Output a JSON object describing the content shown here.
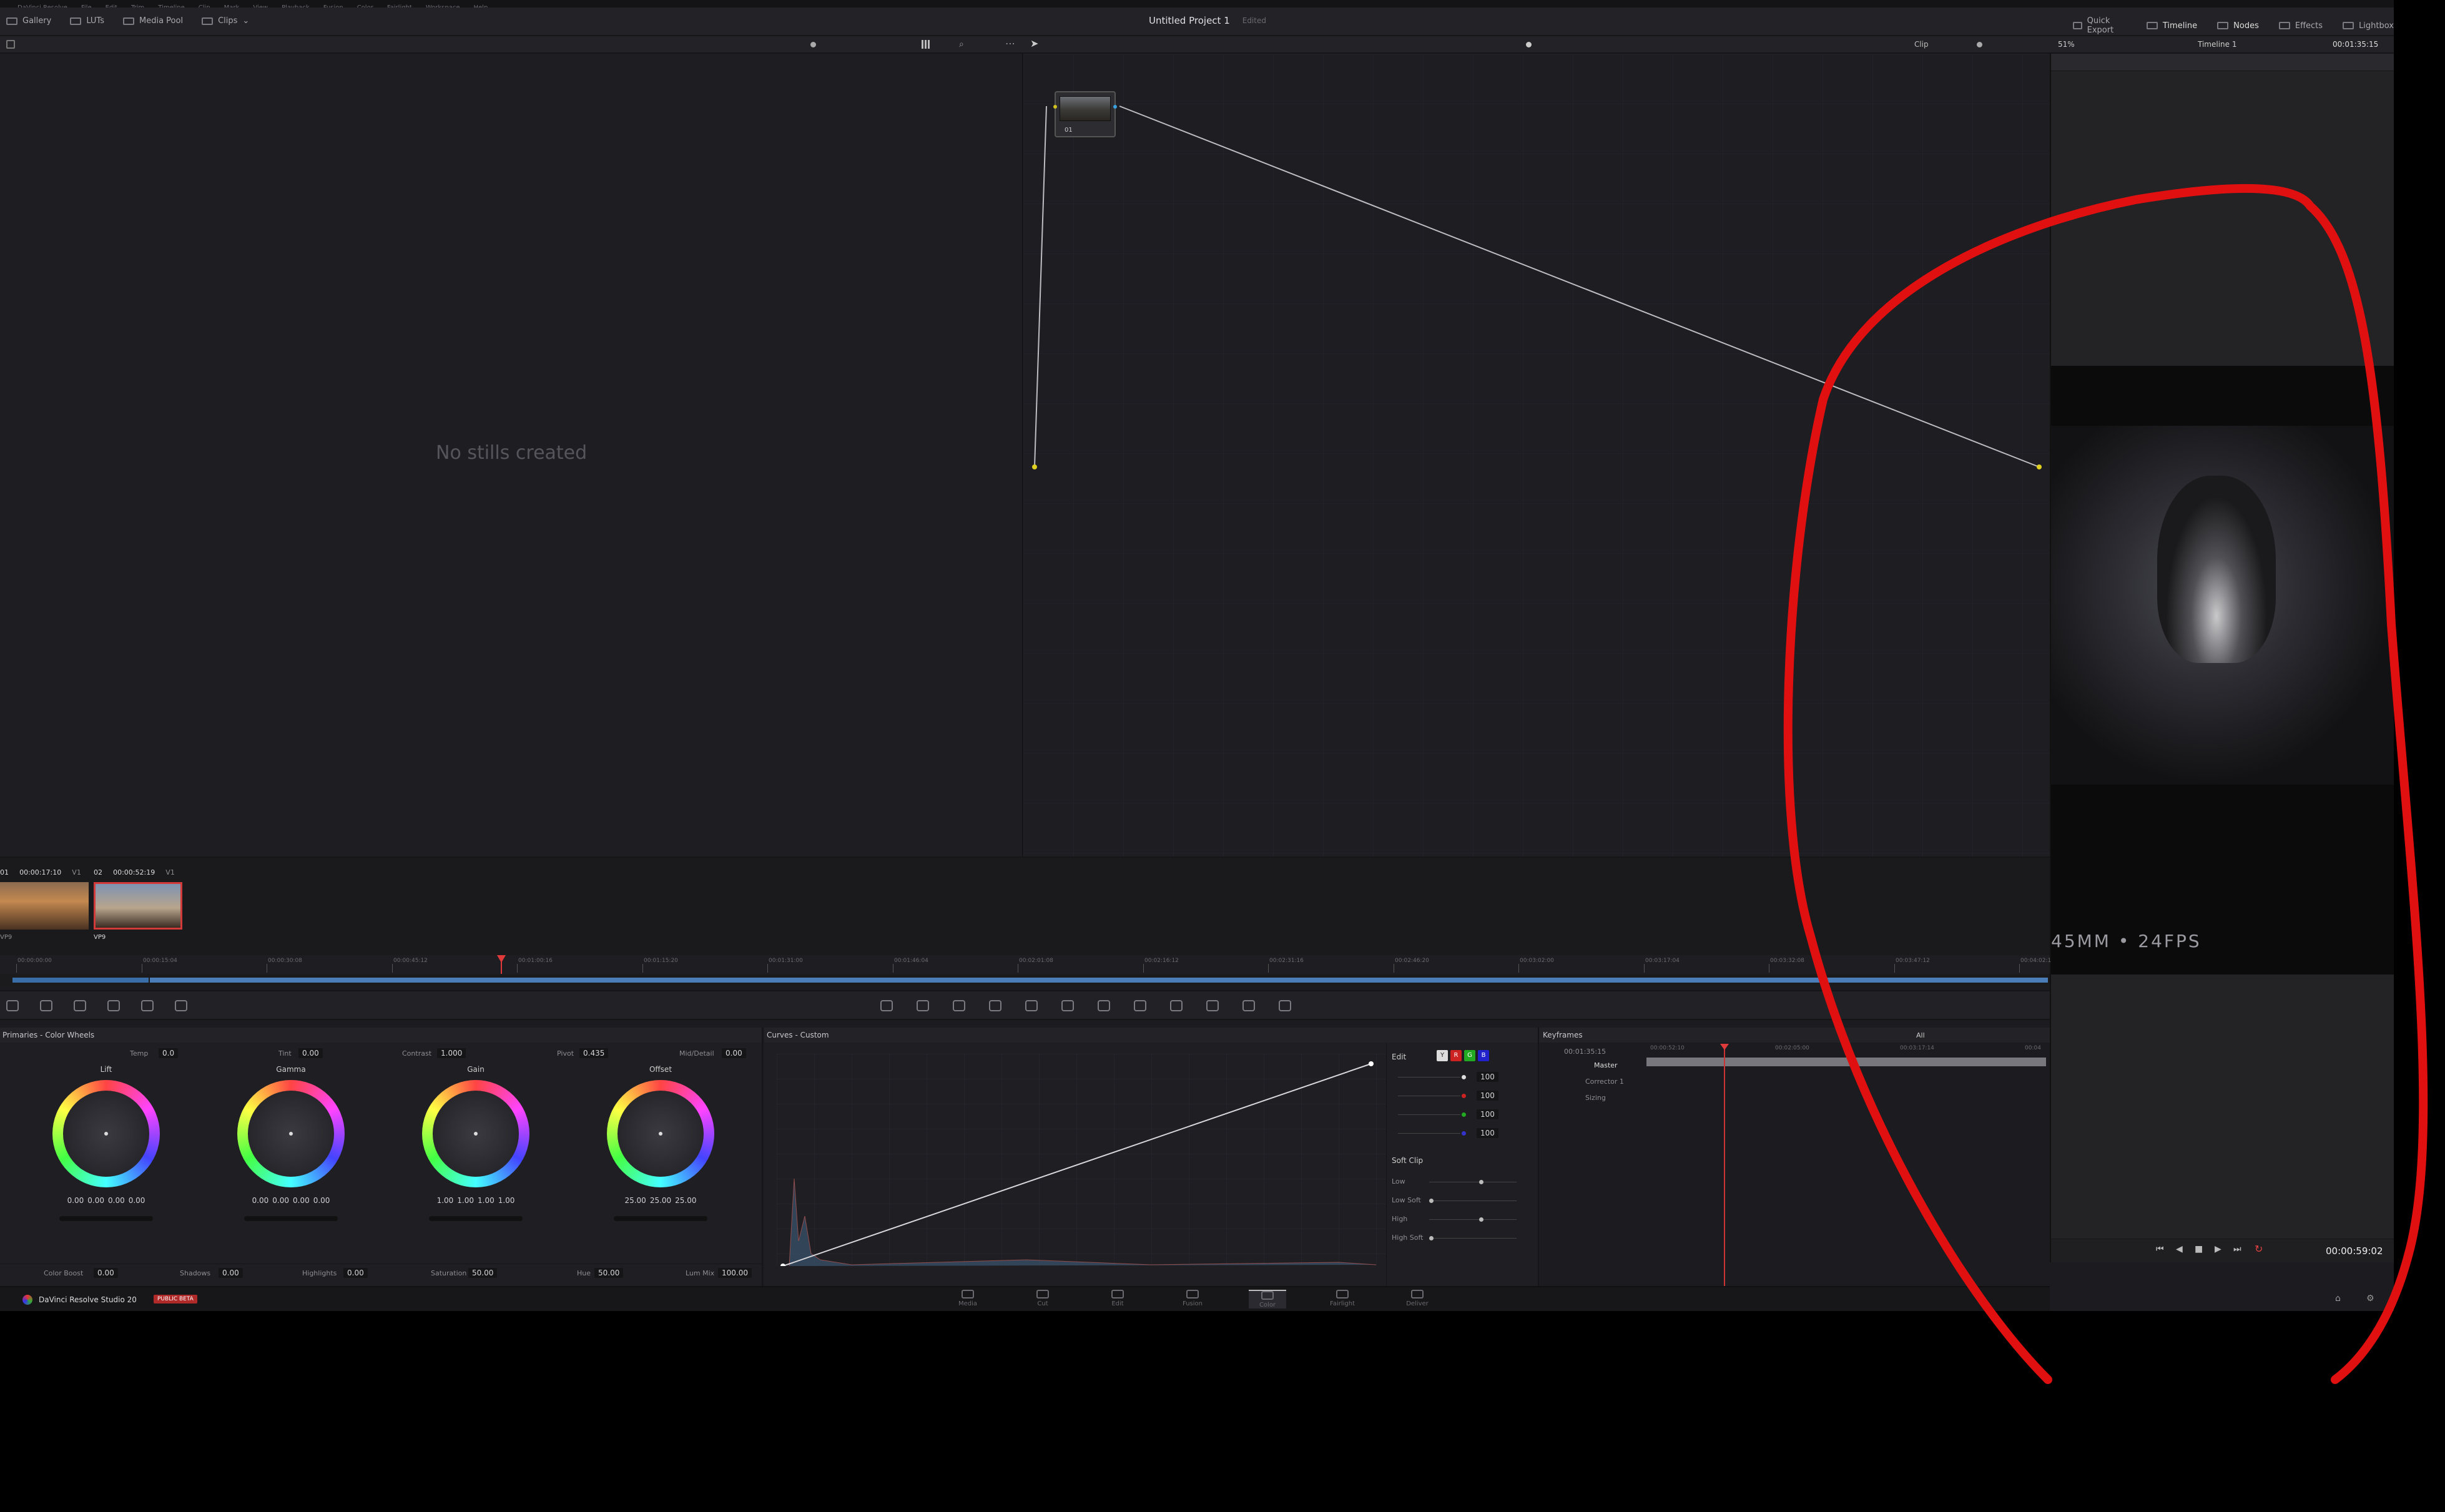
{
  "menubar": [
    "DaVinci Resolve",
    "File",
    "Edit",
    "Trim",
    "Timeline",
    "Clip",
    "Mark",
    "View",
    "Playback",
    "Fusion",
    "Color",
    "Fairlight",
    "Workspace",
    "Help"
  ],
  "toolbar": {
    "left": [
      "Gallery",
      "LUTs",
      "Media Pool",
      "Clips"
    ],
    "project_title": "Untitled Project 1",
    "project_status": "Edited",
    "right": [
      "Quick Export",
      "Timeline",
      "Nodes",
      "Effects",
      "Lightbox"
    ]
  },
  "subbar": {
    "clip_mode": "Clip",
    "zoom": "51%",
    "timeline_name": "Timeline 1",
    "timecode": "00:01:35:15"
  },
  "gallery": {
    "empty_text": "No stills created"
  },
  "node": {
    "label": "01"
  },
  "viewer": {
    "lens_text": "45MM  •  24FPS",
    "timecode": "00:00:59:02"
  },
  "thumbnails": [
    {
      "index": "01",
      "timecode": "00:00:17:10",
      "track": "V1",
      "codec": "VP9"
    },
    {
      "index": "02",
      "timecode": "00:00:52:19",
      "track": "V1",
      "codec": "VP9"
    }
  ],
  "ruler_ticks": [
    "00:00:00:00",
    "00:00:15:04",
    "00:00:30:08",
    "00:00:45:12",
    "00:01:00:16",
    "00:01:15:20",
    "00:01:31:00",
    "00:01:46:04",
    "00:02:01:08",
    "00:02:16:12",
    "00:02:31:16",
    "00:02:46:20",
    "00:03:02:00",
    "00:03:17:04",
    "00:03:32:08",
    "00:03:47:12",
    "00:04:02:1"
  ],
  "primaries": {
    "title": "Primaries - Color Wheels",
    "temp_label": "Temp",
    "temp": "0.0",
    "tint_label": "Tint",
    "tint": "0.00",
    "contrast_label": "Contrast",
    "contrast": "1.000",
    "pivot_label": "Pivot",
    "pivot": "0.435",
    "middetail_label": "Mid/Detail",
    "middetail": "0.00",
    "wheels": [
      {
        "name": "Lift",
        "values": [
          "0.00",
          "0.00",
          "0.00",
          "0.00"
        ]
      },
      {
        "name": "Gamma",
        "values": [
          "0.00",
          "0.00",
          "0.00",
          "0.00"
        ]
      },
      {
        "name": "Gain",
        "values": [
          "1.00",
          "1.00",
          "1.00",
          "1.00"
        ]
      },
      {
        "name": "Offset",
        "values": [
          "25.00",
          "25.00",
          "25.00"
        ]
      }
    ],
    "bottom": {
      "colorboost_label": "Color Boost",
      "colorboost": "0.00",
      "shadows_label": "Shadows",
      "shadows": "0.00",
      "highlights_label": "Highlights",
      "highlights": "0.00",
      "saturation_label": "Saturation",
      "saturation": "50.00",
      "hue_label": "Hue",
      "hue": "50.00",
      "lummix_label": "Lum Mix",
      "lummix": "100.00"
    }
  },
  "curves": {
    "title": "Curves - Custom",
    "edit_label": "Edit",
    "channels": [
      "Y",
      "R",
      "G",
      "B"
    ],
    "edit_values": [
      "100",
      "100",
      "100",
      "100"
    ],
    "softclip_label": "Soft Clip",
    "softclip_rows": [
      "Low",
      "Low Soft",
      "High",
      "High Soft"
    ]
  },
  "keyframes": {
    "title": "Keyframes",
    "filter": "All",
    "timecode": "00:01:35:15",
    "ticks": [
      "00:00:52:10",
      "00:02:05:00",
      "00:03:17:14",
      "00:04"
    ],
    "rows": [
      "Master",
      "Corrector 1",
      "Sizing"
    ]
  },
  "bottombar": {
    "app_name": "DaVinci Resolve Studio 20",
    "badge": "PUBLIC BETA",
    "pages": [
      "Media",
      "Cut",
      "Edit",
      "Fusion",
      "Color",
      "Fairlight",
      "Deliver"
    ],
    "active_page": "Color"
  },
  "colors": {
    "annotation": "#e01010",
    "playhead": "#e03a3a",
    "accent": "#d23a3a"
  }
}
